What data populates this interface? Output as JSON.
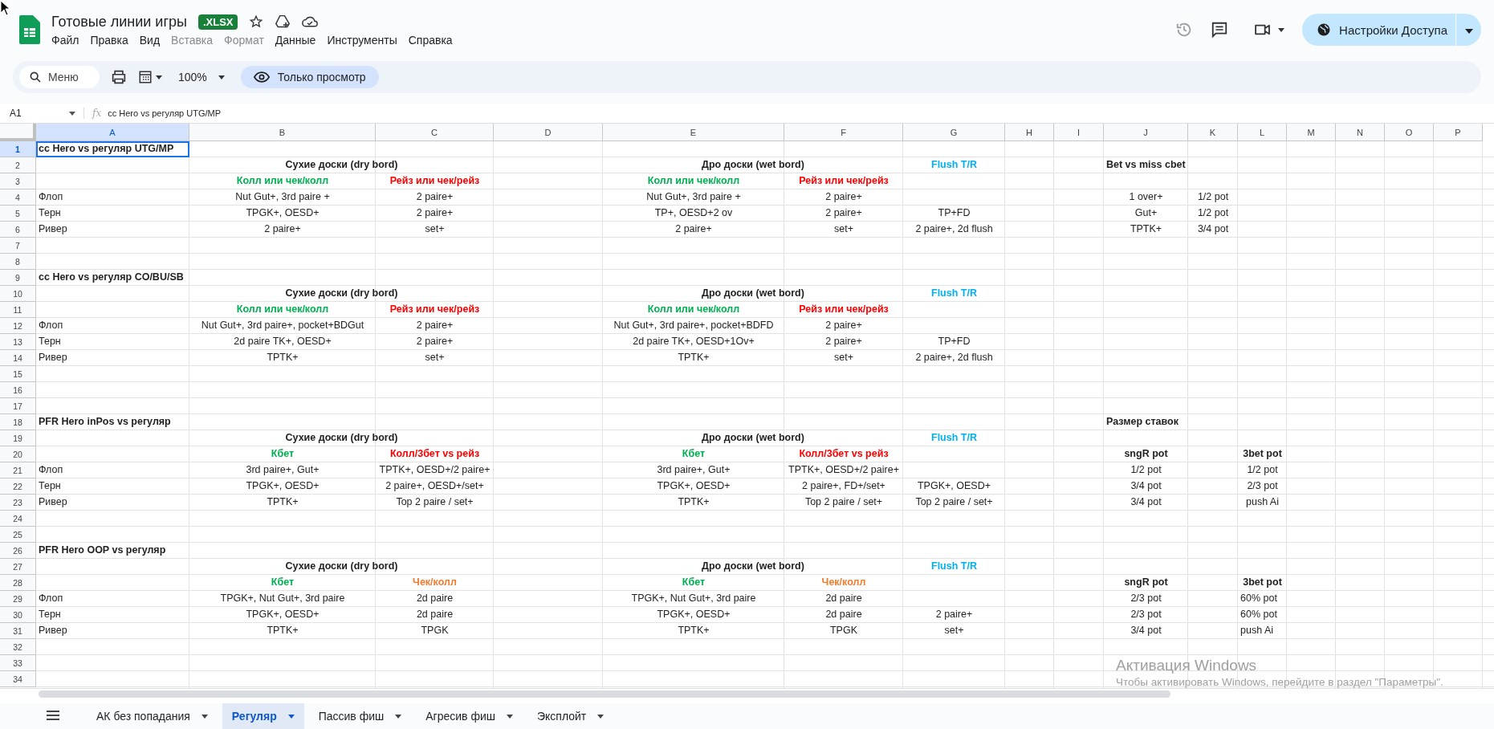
{
  "document": {
    "title": "Готовые линии игры",
    "badge": ".XLSX"
  },
  "menu": [
    {
      "label": "Файл",
      "disabled": false
    },
    {
      "label": "Правка",
      "disabled": false
    },
    {
      "label": "Вид",
      "disabled": false
    },
    {
      "label": "Вставка",
      "disabled": true
    },
    {
      "label": "Формат",
      "disabled": true
    },
    {
      "label": "Данные",
      "disabled": false
    },
    {
      "label": "Инструменты",
      "disabled": false
    },
    {
      "label": "Справка",
      "disabled": false
    }
  ],
  "share_button": {
    "label": "Настройки Доступа"
  },
  "toolbar": {
    "search": {
      "placeholder": "Меню"
    },
    "zoom": "100%",
    "mode_button": "Только просмотр"
  },
  "formula_bar": {
    "cell_ref": "A1",
    "fx_label": "fx",
    "content": "cc Hero vs регуляр UTG/MP"
  },
  "columns": [
    {
      "label": "A",
      "selected": true
    },
    {
      "label": "B",
      "selected": false
    },
    {
      "label": "C",
      "selected": false
    },
    {
      "label": "D",
      "selected": false
    },
    {
      "label": "E",
      "selected": false
    },
    {
      "label": "F",
      "selected": false
    },
    {
      "label": "G",
      "selected": false
    },
    {
      "label": "H",
      "selected": false
    },
    {
      "label": "I",
      "selected": false
    },
    {
      "label": "J",
      "selected": false
    },
    {
      "label": "K",
      "selected": false
    },
    {
      "label": "L",
      "selected": false
    },
    {
      "label": "M",
      "selected": false
    },
    {
      "label": "N",
      "selected": false
    },
    {
      "label": "O",
      "selected": false
    },
    {
      "label": "P",
      "selected": false
    }
  ],
  "rows": [
    {
      "number": "1",
      "selected": true,
      "cells": {
        "A": {
          "text": "cc Hero vs регуляр UTG/MP",
          "kind": "title"
        }
      }
    },
    {
      "number": "2",
      "selected": false,
      "cells": {
        "B": {
          "text": "Сухие доски (dry bord)",
          "kind": "heading",
          "merged": true
        },
        "E": {
          "text": "Дро доски (wet bord)",
          "kind": "heading",
          "merged": true
        },
        "G": {
          "text": "Flush T/R",
          "kind": "heading",
          "color": "#00b0f0"
        },
        "J": {
          "text": "Bet vs miss cbet",
          "kind": "title"
        }
      }
    },
    {
      "number": "3",
      "selected": false,
      "cells": {
        "B": {
          "text": "Колл или чек/колл",
          "kind": "heading",
          "color": "#00b050"
        },
        "C": {
          "text": "Рейз или чек/рейз",
          "kind": "heading",
          "color": "#ff0000"
        },
        "E": {
          "text": "Колл или чек/колл",
          "kind": "heading",
          "color": "#00b050"
        },
        "F": {
          "text": "Рейз или чек/рейз",
          "kind": "heading",
          "color": "#ff0000"
        }
      }
    },
    {
      "number": "4",
      "selected": false,
      "cells": {
        "A": {
          "text": "Флоп",
          "kind": "label"
        },
        "B": {
          "text": "Nut Gut+, 3rd paire +",
          "kind": "value"
        },
        "C": {
          "text": "2 paire+",
          "kind": "value"
        },
        "E": {
          "text": "Nut Gut+, 3rd paire +",
          "kind": "value"
        },
        "F": {
          "text": "2 paire+",
          "kind": "value"
        },
        "J": {
          "text": "1 over+",
          "kind": "value"
        },
        "K": {
          "text": "1/2 pot",
          "kind": "value"
        }
      }
    },
    {
      "number": "5",
      "selected": false,
      "cells": {
        "A": {
          "text": "Терн",
          "kind": "label"
        },
        "B": {
          "text": "TPGK+, OESD+",
          "kind": "value"
        },
        "C": {
          "text": "2 paire+",
          "kind": "value"
        },
        "E": {
          "text": "TP+, OESD+2 ov",
          "kind": "value"
        },
        "F": {
          "text": "2 paire+",
          "kind": "value"
        },
        "G": {
          "text": "TP+FD",
          "kind": "value"
        },
        "J": {
          "text": "Gut+",
          "kind": "value"
        },
        "K": {
          "text": "1/2 pot",
          "kind": "value"
        }
      }
    },
    {
      "number": "6",
      "selected": false,
      "cells": {
        "A": {
          "text": "Ривер",
          "kind": "label"
        },
        "B": {
          "text": "2 paire+",
          "kind": "value"
        },
        "C": {
          "text": "set+",
          "kind": "value"
        },
        "E": {
          "text": "2 paire+",
          "kind": "value"
        },
        "F": {
          "text": "set+",
          "kind": "value"
        },
        "G": {
          "text": "2 paire+, 2d flush",
          "kind": "value"
        },
        "J": {
          "text": "TPTK+",
          "kind": "value"
        },
        "K": {
          "text": "3/4 pot",
          "kind": "value"
        }
      }
    },
    {
      "number": "7",
      "selected": false,
      "cells": {}
    },
    {
      "number": "8",
      "selected": false,
      "cells": {}
    },
    {
      "number": "9",
      "selected": false,
      "cells": {
        "A": {
          "text": "cc Hero vs регуляр CO/BU/SB",
          "kind": "title"
        }
      }
    },
    {
      "number": "10",
      "selected": false,
      "cells": {
        "B": {
          "text": "Сухие доски (dry bord)",
          "kind": "heading",
          "merged": true
        },
        "E": {
          "text": "Дро доски (wet bord)",
          "kind": "heading",
          "merged": true
        },
        "G": {
          "text": "Flush T/R",
          "kind": "heading",
          "color": "#00b0f0"
        }
      }
    },
    {
      "number": "11",
      "selected": false,
      "cells": {
        "B": {
          "text": "Колл или чек/колл",
          "kind": "heading",
          "color": "#00b050"
        },
        "C": {
          "text": "Рейз или чек/рейз",
          "kind": "heading",
          "color": "#ff0000"
        },
        "E": {
          "text": "Колл или чек/колл",
          "kind": "heading",
          "color": "#00b050"
        },
        "F": {
          "text": "Рейз или чек/рейз",
          "kind": "heading",
          "color": "#ff0000"
        }
      }
    },
    {
      "number": "12",
      "selected": false,
      "cells": {
        "A": {
          "text": "Флоп",
          "kind": "label"
        },
        "B": {
          "text": "Nut Gut+, 3rd paire+, pocket+BDGut",
          "kind": "value"
        },
        "C": {
          "text": "2 paire+",
          "kind": "value"
        },
        "E": {
          "text": "Nut Gut+, 3rd paire+, pocket+BDFD",
          "kind": "value"
        },
        "F": {
          "text": "2 paire+",
          "kind": "value"
        }
      }
    },
    {
      "number": "13",
      "selected": false,
      "cells": {
        "A": {
          "text": "Терн",
          "kind": "label"
        },
        "B": {
          "text": "2d paire TK+, OESD+",
          "kind": "value"
        },
        "C": {
          "text": "2 paire+",
          "kind": "value"
        },
        "E": {
          "text": "2d paire TK+, OESD+1Ov+",
          "kind": "value"
        },
        "F": {
          "text": "2 paire+",
          "kind": "value"
        },
        "G": {
          "text": "TP+FD",
          "kind": "value"
        }
      }
    },
    {
      "number": "14",
      "selected": false,
      "cells": {
        "A": {
          "text": "Ривер",
          "kind": "label"
        },
        "B": {
          "text": "TPTK+",
          "kind": "value"
        },
        "C": {
          "text": "set+",
          "kind": "value"
        },
        "E": {
          "text": "TPTK+",
          "kind": "value"
        },
        "F": {
          "text": "set+",
          "kind": "value"
        },
        "G": {
          "text": "2 paire+, 2d flush",
          "kind": "value"
        }
      }
    },
    {
      "number": "15",
      "selected": false,
      "cells": {}
    },
    {
      "number": "16",
      "selected": false,
      "cells": {}
    },
    {
      "number": "17",
      "selected": false,
      "cells": {}
    },
    {
      "number": "18",
      "selected": false,
      "cells": {
        "A": {
          "text": "PFR Hero inPos vs регуляр",
          "kind": "title"
        },
        "J": {
          "text": "Размер ставок",
          "kind": "title"
        }
      }
    },
    {
      "number": "19",
      "selected": false,
      "cells": {
        "B": {
          "text": "Сухие доски (dry bord)",
          "kind": "heading",
          "merged": true
        },
        "E": {
          "text": "Дро доски (wet bord)",
          "kind": "heading",
          "merged": true
        },
        "G": {
          "text": "Flush T/R",
          "kind": "heading",
          "color": "#00b0f0"
        }
      }
    },
    {
      "number": "20",
      "selected": false,
      "cells": {
        "B": {
          "text": "Кбет",
          "kind": "heading",
          "color": "#00b050"
        },
        "C": {
          "text": "Колл/3бет vs рейз",
          "kind": "heading",
          "color": "#ff0000"
        },
        "E": {
          "text": "Кбет",
          "kind": "heading",
          "color": "#00b050"
        },
        "F": {
          "text": "Колл/3бет vs рейз",
          "kind": "heading",
          "color": "#ff0000"
        },
        "J": {
          "text": "sngR pot",
          "kind": "heading"
        },
        "L": {
          "text": "3bet pot",
          "kind": "heading"
        }
      }
    },
    {
      "number": "21",
      "selected": false,
      "cells": {
        "A": {
          "text": "Флоп",
          "kind": "label"
        },
        "B": {
          "text": "3rd paire+, Gut+",
          "kind": "value"
        },
        "C": {
          "text": "TPTK+, OESD+/2 paire+",
          "kind": "value"
        },
        "E": {
          "text": "3rd paire+, Gut+",
          "kind": "value"
        },
        "F": {
          "text": "TPTK+, OESD+/2 paire+",
          "kind": "value"
        },
        "J": {
          "text": "1/2 pot",
          "kind": "value"
        },
        "L": {
          "text": "1/2 pot",
          "kind": "value"
        }
      }
    },
    {
      "number": "22",
      "selected": false,
      "cells": {
        "A": {
          "text": "Терн",
          "kind": "label"
        },
        "B": {
          "text": "TPGK+, OESD+",
          "kind": "value"
        },
        "C": {
          "text": "2 paire+, OESD+/set+",
          "kind": "value"
        },
        "E": {
          "text": "TPGK+, OESD+",
          "kind": "value"
        },
        "F": {
          "text": "2 paire+, FD+/set+",
          "kind": "value"
        },
        "G": {
          "text": "TPGK+, OESD+",
          "kind": "value"
        },
        "J": {
          "text": "3/4 pot",
          "kind": "value"
        },
        "L": {
          "text": "2/3 pot",
          "kind": "value"
        }
      }
    },
    {
      "number": "23",
      "selected": false,
      "cells": {
        "A": {
          "text": "Ривер",
          "kind": "label"
        },
        "B": {
          "text": "TPTK+",
          "kind": "value"
        },
        "C": {
          "text": "Top 2 paire / set+",
          "kind": "value"
        },
        "E": {
          "text": "TPTK+",
          "kind": "value"
        },
        "F": {
          "text": "Top 2 paire / set+",
          "kind": "value"
        },
        "G": {
          "text": "Top 2 paire / set+",
          "kind": "value"
        },
        "J": {
          "text": "3/4 pot",
          "kind": "value"
        },
        "L": {
          "text": "push Ai",
          "kind": "value"
        }
      }
    },
    {
      "number": "24",
      "selected": false,
      "cells": {}
    },
    {
      "number": "25",
      "selected": false,
      "cells": {}
    },
    {
      "number": "26",
      "selected": false,
      "cells": {
        "A": {
          "text": "PFR Hero OOP vs регуляр",
          "kind": "title"
        }
      }
    },
    {
      "number": "27",
      "selected": false,
      "cells": {
        "B": {
          "text": "Сухие доски (dry bord)",
          "kind": "heading",
          "merged": true
        },
        "E": {
          "text": "Дро доски (wet bord)",
          "kind": "heading",
          "merged": true
        },
        "G": {
          "text": "Flush T/R",
          "kind": "heading",
          "color": "#00b0f0"
        }
      }
    },
    {
      "number": "28",
      "selected": false,
      "cells": {
        "B": {
          "text": "Кбет",
          "kind": "heading",
          "color": "#00b050"
        },
        "C": {
          "text": "Чек/колл",
          "kind": "heading",
          "color": "#ed7d31"
        },
        "E": {
          "text": "Кбет",
          "kind": "heading",
          "color": "#00b050"
        },
        "F": {
          "text": "Чек/колл",
          "kind": "heading",
          "color": "#ed7d31"
        },
        "J": {
          "text": "sngR pot",
          "kind": "heading"
        },
        "L": {
          "text": "3bet pot",
          "kind": "heading"
        }
      }
    },
    {
      "number": "29",
      "selected": false,
      "cells": {
        "A": {
          "text": "Флоп",
          "kind": "label"
        },
        "B": {
          "text": "TPGK+, Nut Gut+, 3rd paire",
          "kind": "value"
        },
        "C": {
          "text": "2d paire",
          "kind": "value"
        },
        "E": {
          "text": "TPGK+, Nut Gut+, 3rd paire",
          "kind": "value"
        },
        "F": {
          "text": "2d paire",
          "kind": "value"
        },
        "J": {
          "text": "2/3 pot",
          "kind": "value"
        },
        "L": {
          "text": "60% pot",
          "kind": "label"
        }
      }
    },
    {
      "number": "30",
      "selected": false,
      "cells": {
        "A": {
          "text": "Терн",
          "kind": "label"
        },
        "B": {
          "text": "TPGK+, OESD+",
          "kind": "value"
        },
        "C": {
          "text": "2d paire",
          "kind": "value"
        },
        "E": {
          "text": "TPGK+, OESD+",
          "kind": "value"
        },
        "F": {
          "text": "2d paire",
          "kind": "value"
        },
        "G": {
          "text": "2 paire+",
          "kind": "value"
        },
        "J": {
          "text": "2/3 pot",
          "kind": "value"
        },
        "L": {
          "text": "60% pot",
          "kind": "label"
        }
      }
    },
    {
      "number": "31",
      "selected": false,
      "cells": {
        "A": {
          "text": "Ривер",
          "kind": "label"
        },
        "B": {
          "text": "TPTK+",
          "kind": "value"
        },
        "C": {
          "text": "TPGK",
          "kind": "value"
        },
        "E": {
          "text": "TPTK+",
          "kind": "value"
        },
        "F": {
          "text": "TPGK",
          "kind": "value"
        },
        "G": {
          "text": "set+",
          "kind": "value"
        },
        "J": {
          "text": "3/4 pot",
          "kind": "value"
        },
        "L": {
          "text": "push Ai",
          "kind": "label"
        }
      }
    },
    {
      "number": "32",
      "selected": false,
      "cells": {}
    },
    {
      "number": "33",
      "selected": false,
      "cells": {}
    },
    {
      "number": "34",
      "selected": false,
      "cells": {}
    }
  ],
  "sheet_tabs": [
    {
      "label": "АК без попадания",
      "selected": false
    },
    {
      "label": "Регуляр",
      "selected": true
    },
    {
      "label": "Пассив фиш",
      "selected": false
    },
    {
      "label": "Агресив фиш",
      "selected": false
    },
    {
      "label": "Эксплойт",
      "selected": false
    }
  ],
  "os_notice": {
    "title": "Активация Windows",
    "text": "Чтобы активировать Windows, перейдите в раздел \"Параметры\"."
  }
}
